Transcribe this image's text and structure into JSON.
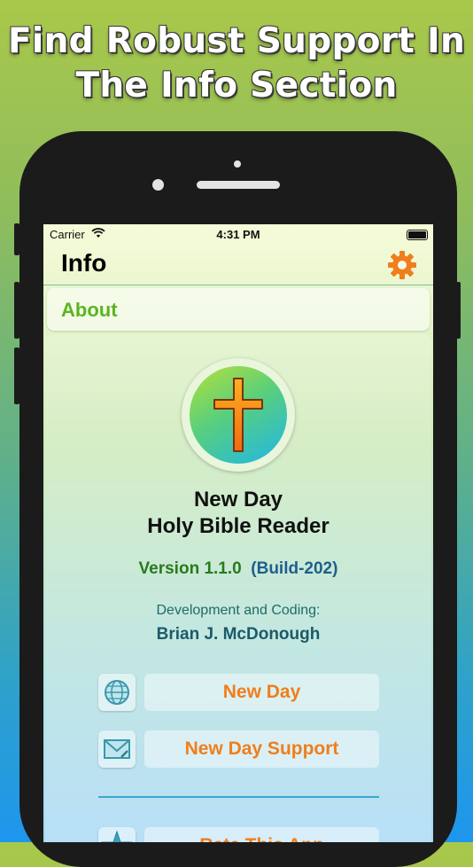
{
  "promo": {
    "line1": "Find Robust Support In",
    "line2": "The Info Section"
  },
  "status_bar": {
    "carrier": "Carrier",
    "time": "4:31 PM"
  },
  "nav": {
    "title": "Info",
    "settings_icon": "gear-icon"
  },
  "section": {
    "label": "About"
  },
  "app": {
    "name_line1": "New Day",
    "name_line2": "Holy Bible Reader",
    "version": "Version 1.1.0",
    "build": "(Build-202)",
    "dev_label": "Development and Coding:",
    "dev_name": "Brian J. McDonough"
  },
  "links": [
    {
      "label": "New Day",
      "icon": "globe-www-icon"
    },
    {
      "label": "New Day Support",
      "icon": "mail-icon"
    },
    {
      "label": "Rate This App",
      "icon": "star-icon"
    }
  ],
  "colors": {
    "accent_orange": "#f07e1c",
    "about_green": "#5cb422",
    "version_green": "#2a7a1c",
    "version_blue": "#1d5f8c"
  }
}
